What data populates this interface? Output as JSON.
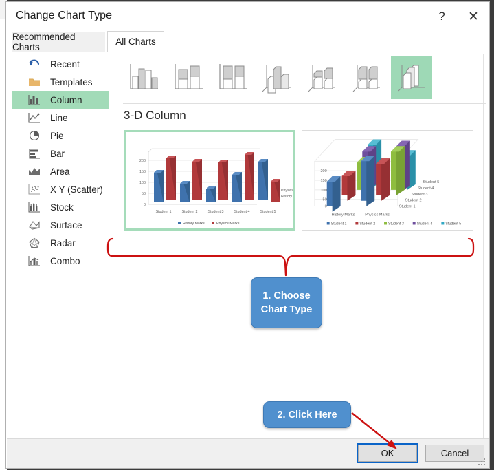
{
  "window": {
    "title": "Change Chart Type",
    "help_label": "?",
    "close_label": "✕"
  },
  "tabs": [
    {
      "label": "Recommended Charts",
      "active": false
    },
    {
      "label": "All Charts",
      "active": true
    }
  ],
  "sidebar": {
    "items": [
      {
        "label": "Recent",
        "icon": "recent-undo-icon",
        "selected": false
      },
      {
        "label": "Templates",
        "icon": "folder-icon",
        "selected": false
      },
      {
        "label": "Column",
        "icon": "column-chart-icon",
        "selected": true
      },
      {
        "label": "Line",
        "icon": "line-chart-icon",
        "selected": false
      },
      {
        "label": "Pie",
        "icon": "pie-chart-icon",
        "selected": false
      },
      {
        "label": "Bar",
        "icon": "bar-chart-icon",
        "selected": false
      },
      {
        "label": "Area",
        "icon": "area-chart-icon",
        "selected": false
      },
      {
        "label": "X Y (Scatter)",
        "icon": "scatter-chart-icon",
        "selected": false
      },
      {
        "label": "Stock",
        "icon": "stock-chart-icon",
        "selected": false
      },
      {
        "label": "Surface",
        "icon": "surface-chart-icon",
        "selected": false
      },
      {
        "label": "Radar",
        "icon": "radar-chart-icon",
        "selected": false
      },
      {
        "label": "Combo",
        "icon": "combo-chart-icon",
        "selected": false
      }
    ],
    "selected_index": 2
  },
  "gallery": {
    "thumbnails": [
      {
        "name": "clustered-column",
        "selected": false
      },
      {
        "name": "stacked-column",
        "selected": false
      },
      {
        "name": "100-percent-stacked-column",
        "selected": false
      },
      {
        "name": "3d-clustered-column",
        "selected": false
      },
      {
        "name": "3d-stacked-column",
        "selected": false
      },
      {
        "name": "3d-100-percent-stacked-column",
        "selected": false
      },
      {
        "name": "3d-column",
        "selected": true
      }
    ],
    "selected_index": 6
  },
  "preview": {
    "heading": "3-D Column",
    "cards": [
      {
        "name": "3d-column-preview-a",
        "selected": true
      },
      {
        "name": "3d-column-preview-b",
        "selected": false
      }
    ]
  },
  "callouts": {
    "step1_line1": "1. Choose",
    "step1_line2": "Chart Type",
    "step2": "2. Click Here"
  },
  "footer": {
    "ok_label": "OK",
    "cancel_label": "Cancel"
  },
  "colors": {
    "selection_green": "#a2dbb8",
    "callout_blue": "#5090ce",
    "annotation_red": "#cc1111",
    "focus_blue": "#0a64c8",
    "series_history": "#3f72ad",
    "series_physics": "#b1393b"
  },
  "chart_data": [
    {
      "type": "bar",
      "name": "3d-column-preview-a",
      "title": "",
      "categories": [
        "Student 1",
        "Student 2",
        "Student 3",
        "Student 4",
        "Student 5"
      ],
      "series": [
        {
          "name": "History Marks",
          "color": "#3f72ad",
          "values": [
            150,
            100,
            75,
            135,
            200
          ]
        },
        {
          "name": "Physics Marks",
          "color": "#b1393b",
          "values": [
            215,
            200,
            198,
            230,
            115
          ]
        }
      ],
      "xlabel": "",
      "ylabel": "",
      "ylim": [
        0,
        250
      ],
      "yticks": [
        0,
        50,
        100,
        150,
        200
      ],
      "depth_axis_labels": [
        "History Marks",
        "Physics Marks"
      ],
      "legend": [
        "History Marks",
        "Physics Marks"
      ],
      "legend_position": "bottom",
      "grid": true
    },
    {
      "type": "bar",
      "name": "3d-column-preview-b",
      "title": "",
      "categories": [
        "History Marks",
        "Physics Marks"
      ],
      "series": [
        {
          "name": "Student 1",
          "color": "#3f72ad",
          "values": [
            150,
            150
          ]
        },
        {
          "name": "Student 2",
          "color": "#b1393b",
          "values": [
            100,
            195
          ]
        },
        {
          "name": "Student 3",
          "color": "#8ebd3f",
          "values": [
            75,
            215
          ]
        },
        {
          "name": "Student 4",
          "color": "#6f4f9e",
          "values": [
            135,
            230
          ]
        },
        {
          "name": "Student 5",
          "color": "#31a8c4",
          "values": [
            200,
            250
          ]
        }
      ],
      "xlabel": "",
      "ylabel": "",
      "ylim": [
        0,
        250
      ],
      "yticks": [
        0,
        50,
        100,
        150,
        200
      ],
      "depth_axis_labels": [
        "Student 1",
        "Student 2",
        "Student 3",
        "Student 4",
        "Student 5"
      ],
      "legend": [
        "Student 1",
        "Student 2",
        "Student 3",
        "Student 4",
        "Student 5"
      ],
      "legend_position": "bottom",
      "grid": true
    }
  ]
}
